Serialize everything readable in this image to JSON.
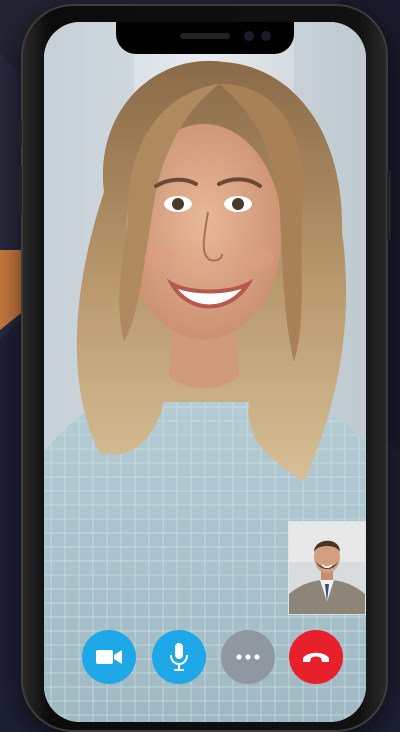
{
  "colors": {
    "background": "#1e2035",
    "accent_orange": "#c97a3f",
    "video_button": "#1ea8e8",
    "mic_button": "#1ea8e8",
    "more_button": "#8f98a0",
    "end_call_button": "#e8202b"
  },
  "call": {
    "main_video": "remote-participant-video",
    "self_view": "self-view-video"
  },
  "controls": [
    {
      "name": "video-camera-button",
      "icon": "video-camera-icon"
    },
    {
      "name": "microphone-button",
      "icon": "microphone-icon"
    },
    {
      "name": "more-options-button",
      "icon": "more-horizontal-icon"
    },
    {
      "name": "end-call-button",
      "icon": "phone-hangup-icon"
    }
  ]
}
